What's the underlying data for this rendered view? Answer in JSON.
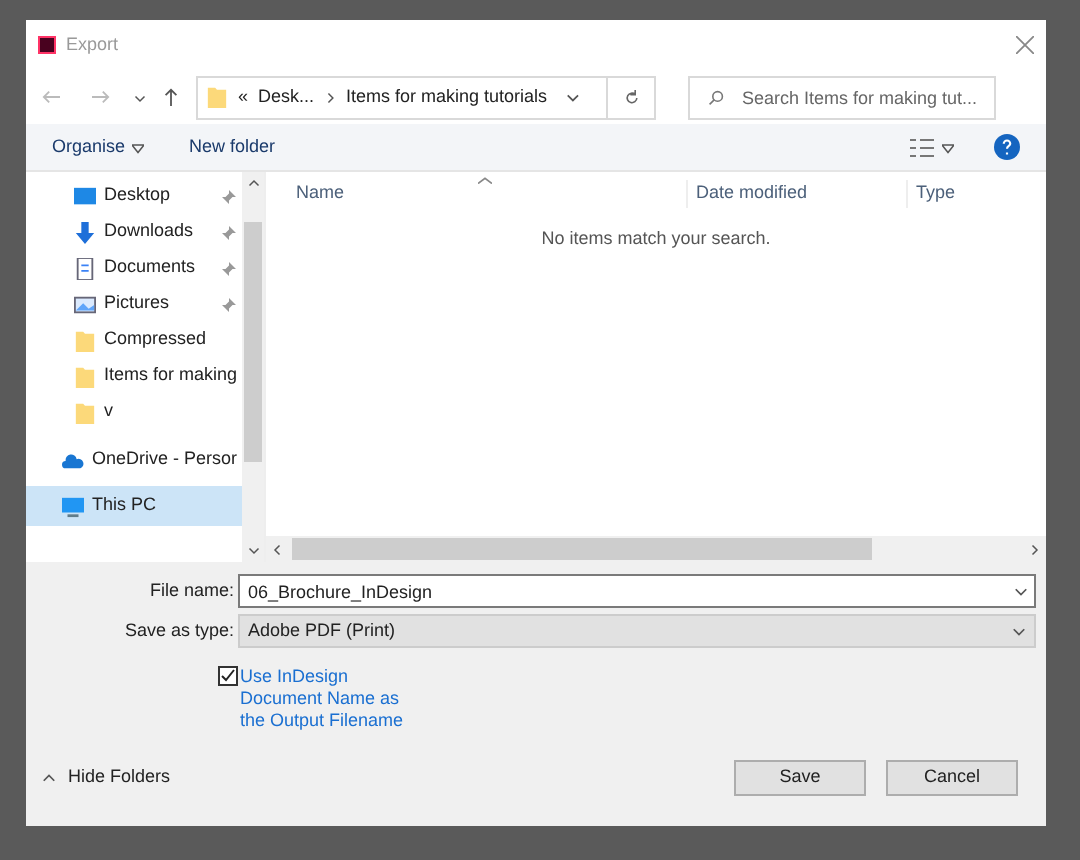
{
  "window": {
    "title": "Export"
  },
  "address": {
    "overflow": "«",
    "crumbs": [
      "Desk...",
      "Items for making tutorials"
    ]
  },
  "search": {
    "placeholder": "Search Items for making tut..."
  },
  "toolbar": {
    "organise": "Organise",
    "new_folder": "New folder"
  },
  "nav": [
    {
      "kind": "desktop",
      "label": "Desktop",
      "pinned": true,
      "selected": false
    },
    {
      "kind": "download",
      "label": "Downloads",
      "pinned": true,
      "selected": false
    },
    {
      "kind": "document",
      "label": "Documents",
      "pinned": true,
      "selected": false
    },
    {
      "kind": "pictures",
      "label": "Pictures",
      "pinned": true,
      "selected": false
    },
    {
      "kind": "folder",
      "label": "Compressed",
      "pinned": false,
      "selected": false
    },
    {
      "kind": "folder",
      "label": "Items for making",
      "pinned": false,
      "selected": false
    },
    {
      "kind": "folder",
      "label": "v",
      "pinned": false,
      "selected": false
    },
    {
      "kind": "cloud",
      "label": "OneDrive - Persor",
      "pinned": false,
      "selected": false
    },
    {
      "kind": "pc",
      "label": "This PC",
      "pinned": false,
      "selected": true
    }
  ],
  "table": {
    "columns": [
      "Name",
      "Date modified",
      "Type"
    ],
    "empty": "No items match your search."
  },
  "file_name": {
    "label": "File name:",
    "value": "06_Brochure_InDesign"
  },
  "save_type": {
    "label": "Save as type:",
    "value": "Adobe PDF (Print)"
  },
  "option": {
    "label": "Use InDesign Document Name as the Output Filename",
    "checked": true
  },
  "hide_folders": "Hide Folders",
  "buttons": [
    "Save",
    "Cancel"
  ]
}
